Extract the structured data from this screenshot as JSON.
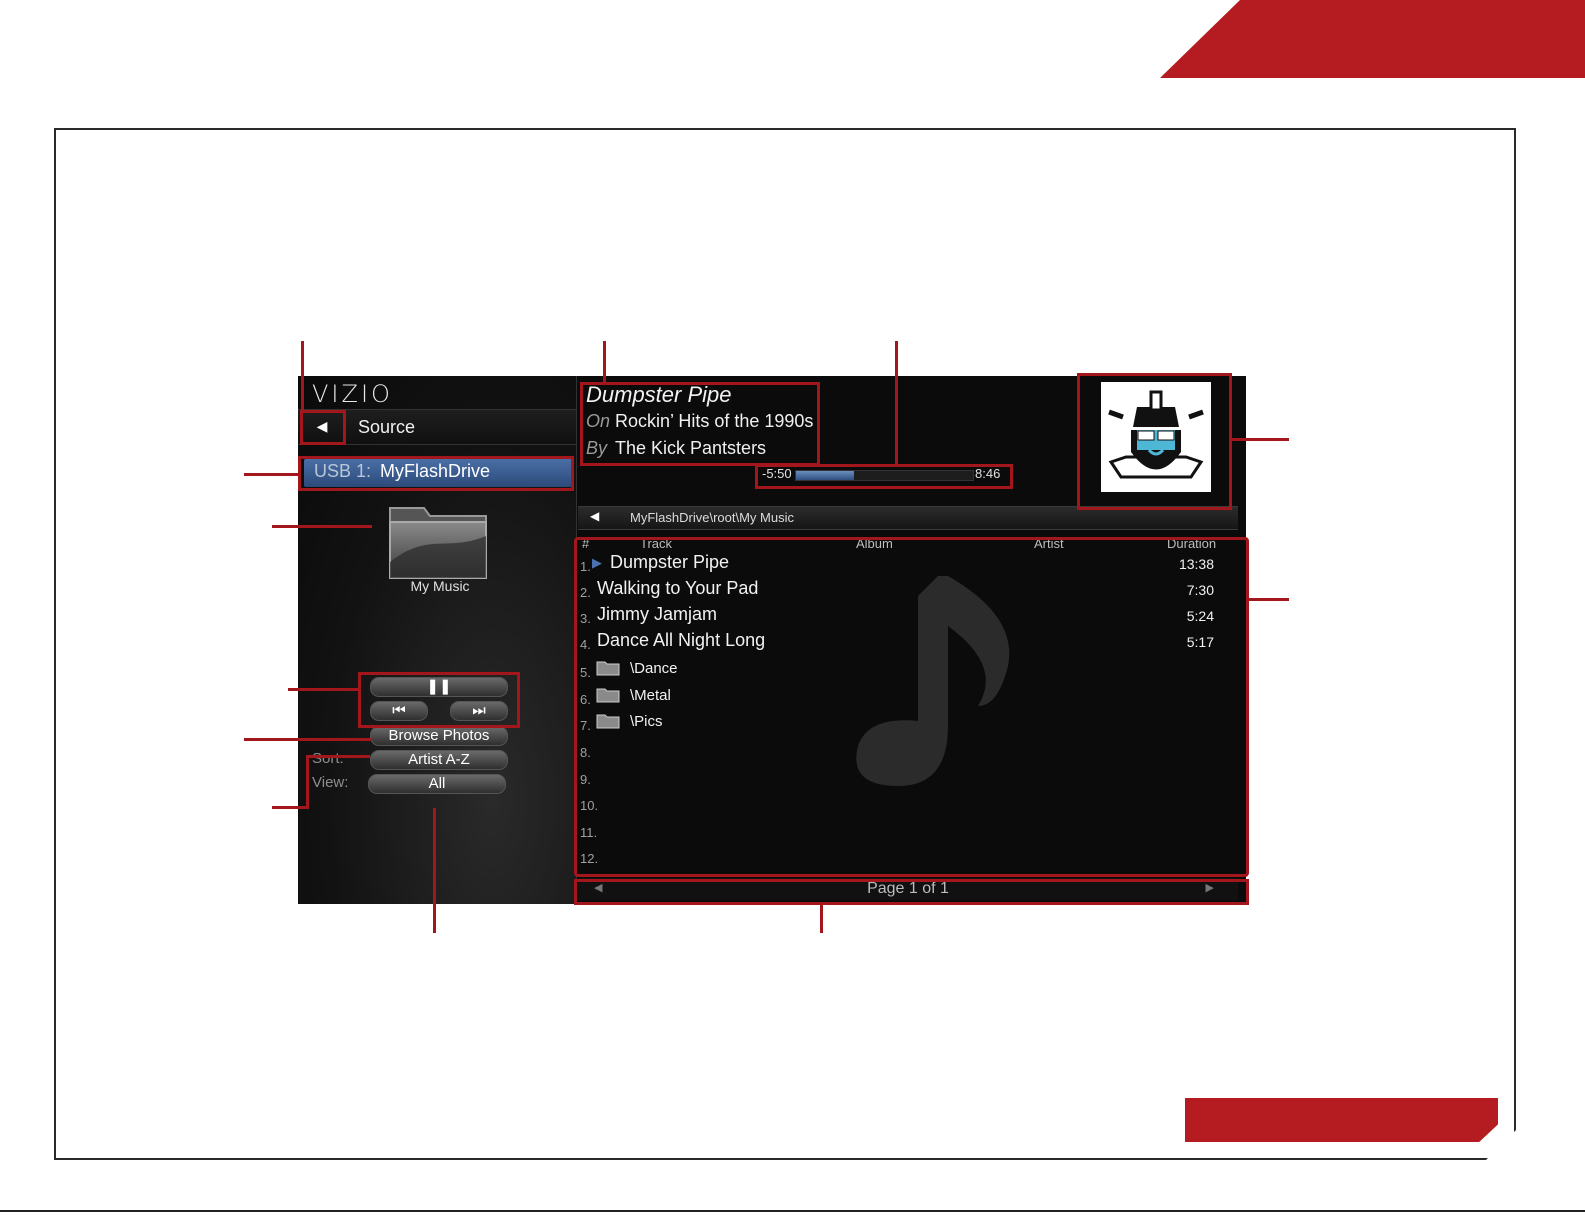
{
  "screen": {
    "logo": "VIZIO",
    "nav": {
      "back_icon": "back-arrow",
      "source_label": "Source"
    },
    "usb": {
      "prefix": "USB 1:",
      "name": "MyFlashDrive"
    },
    "folder": {
      "caption": "My Music",
      "icon": "folder-icon"
    },
    "controls": {
      "pause_icon": "pause-icon",
      "prev_icon": "previous-track-icon",
      "next_icon": "next-track-icon",
      "browse_label": "Browse Photos"
    },
    "sort": {
      "label": "Sort:",
      "value": "Artist A-Z"
    },
    "view": {
      "label": "View:",
      "value": "All"
    },
    "now_playing": {
      "title": "Dumpster Pipe",
      "on_label": "On",
      "album": "Rockin’ Hits of the 1990s",
      "by_label": "By",
      "artist": "The Kick Pantsters",
      "time_remaining": "-5:50",
      "time_total": "8:46",
      "progress": 0.33
    },
    "path": {
      "text": "MyFlashDrive\\root\\My Music"
    },
    "columns": {
      "num": "#",
      "track": "Track",
      "album": "Album",
      "artist": "Artist",
      "duration": "Duration"
    },
    "tracks": [
      {
        "num": "1.",
        "title": "Dumpster Pipe",
        "duration": "13:38"
      },
      {
        "num": "2.",
        "title": "Walking to Your Pad",
        "duration": "7:30"
      },
      {
        "num": "3.",
        "title": "Jimmy Jamjam",
        "duration": "5:24"
      },
      {
        "num": "4.",
        "title": "Dance All Night Long",
        "duration": "5:17"
      }
    ],
    "folders": [
      {
        "num": "5.",
        "name": "\\Dance"
      },
      {
        "num": "6.",
        "name": "\\Metal"
      },
      {
        "num": "7.",
        "name": "\\Pics"
      }
    ],
    "empty_rows": [
      "8.",
      "9.",
      "10.",
      "11.",
      "12."
    ],
    "page": {
      "text": "Page 1 of 1"
    }
  },
  "colors": {
    "accent_red": "#b51c22",
    "callout_red": "#a3171c",
    "highlight_blue": "#3b5f94"
  }
}
